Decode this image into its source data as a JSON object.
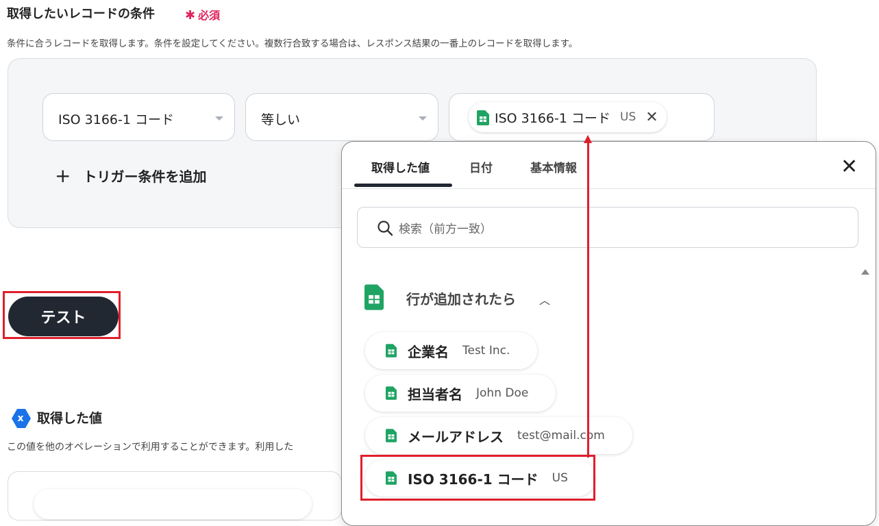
{
  "condition": {
    "title": "取得したいレコードの条件",
    "required_label": "必須",
    "description": "条件に合うレコードを取得します。条件を設定してください。複数行合致する場合は、レスポンス結果の一番上のレコードを取得します。",
    "field_select": "ISO 3166-1 コード",
    "operator_select": "等しい",
    "value_chip": {
      "label": "ISO 3166-1 コード",
      "value": "US",
      "icon": "sheets-icon"
    },
    "add_label": "トリガー条件を追加"
  },
  "test_button": "テスト",
  "values_section": {
    "title": "取得した値",
    "description": "この値を他のオペレーションで利用することができます。利用した"
  },
  "popup": {
    "tabs": [
      "取得した値",
      "日付",
      "基本情報"
    ],
    "active_tab": 0,
    "search_placeholder": "検索（前方一致）",
    "group": {
      "title": "行が追加されたら",
      "icon": "sheets-icon"
    },
    "items": [
      {
        "label": "企業名",
        "value": "Test Inc."
      },
      {
        "label": "担当者名",
        "value": "John Doe"
      },
      {
        "label": "メールアドレス",
        "value": "test@mail.com"
      },
      {
        "label": "ISO 3166-1 コード",
        "value": "US"
      }
    ]
  },
  "colors": {
    "accent_red": "#e01e2b",
    "required_pink": "#e0245e",
    "sheets_green": "#1fa463",
    "dark_button": "#222832",
    "info_blue": "#1a73e8"
  }
}
